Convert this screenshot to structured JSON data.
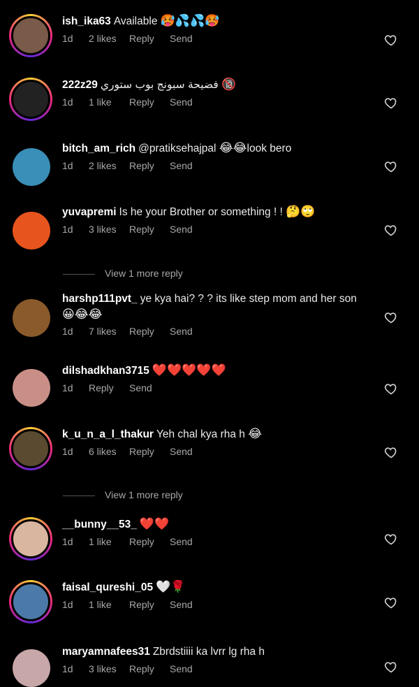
{
  "comments": [
    {
      "user": "ish_ika63",
      "text": "Available",
      "emoji": "🥵💦💦🥵",
      "time": "1d",
      "likes": "2 likes",
      "reply": "Reply",
      "send": "Send",
      "avatar_color": "#7a5a48",
      "ring": true
    },
    {
      "user": "222z29",
      "text": "فضيحة سبونج بوب ستوري",
      "emoji": "🔞",
      "time": "1d",
      "likes": "1 like",
      "reply": "Reply",
      "send": "Send",
      "avatar_color": "#222",
      "ring": true
    },
    {
      "user": "bitch_am_rich",
      "text": "@pratiksehajpal",
      "emoji": "😂😂",
      "text2": "look bero",
      "time": "1d",
      "likes": "2 likes",
      "reply": "Reply",
      "send": "Send",
      "avatar_color": "#3a8fb8",
      "ring": false
    },
    {
      "user": "yuvapremi",
      "text": "Is he your Brother or something ! !",
      "emoji": "🤔🙄",
      "time": "1d",
      "likes": "3 likes",
      "reply": "Reply",
      "send": "Send",
      "avatar_color": "#e8541d",
      "ring": false
    },
    {
      "user": "harshp111pvt_",
      "text": "ye kya hai? ? ?  its like step mom and her son",
      "emoji": "😀😂😂",
      "time": "1d",
      "likes": "7 likes",
      "reply": "Reply",
      "send": "Send",
      "avatar_color": "#8a5a2a",
      "ring": false
    },
    {
      "user": "dilshadkhan3715",
      "text": "",
      "emoji": "❤️❤️❤️❤️❤️",
      "time": "1d",
      "likes": "",
      "reply": "Reply",
      "send": "Send",
      "avatar_color": "#c98f86",
      "ring": false
    },
    {
      "user": "k_u_n_a_l_thakur",
      "text": "Yeh chal kya rha h",
      "emoji": "😂",
      "time": "1d",
      "likes": "6 likes",
      "reply": "Reply",
      "send": "Send",
      "avatar_color": "#5a4a30",
      "ring": true
    },
    {
      "user": "__bunny__53_",
      "text": "",
      "emoji": "❤️❤️",
      "time": "1d",
      "likes": "1 like",
      "reply": "Reply",
      "send": "Send",
      "avatar_color": "#d9b6a0",
      "ring": true
    },
    {
      "user": "faisal_qureshi_05",
      "text": "",
      "emoji": "🤍🌹",
      "time": "1d",
      "likes": "1 like",
      "reply": "Reply",
      "send": "Send",
      "avatar_color": "#4c7aa8",
      "ring": true
    },
    {
      "user": "maryamnafees31",
      "text": "Zbrdstiiii ka lvrr lg rha h",
      "emoji": "",
      "time": "1d",
      "likes": "3 likes",
      "reply": "Reply",
      "send": "Send",
      "avatar_color": "#c8a7a8",
      "ring": false
    }
  ],
  "view_more": [
    "View 1 more reply",
    "View 1 more reply"
  ],
  "colors": {
    "background": "#000000",
    "meta": "#a8a8a8",
    "heart": "#cfcfcf"
  }
}
